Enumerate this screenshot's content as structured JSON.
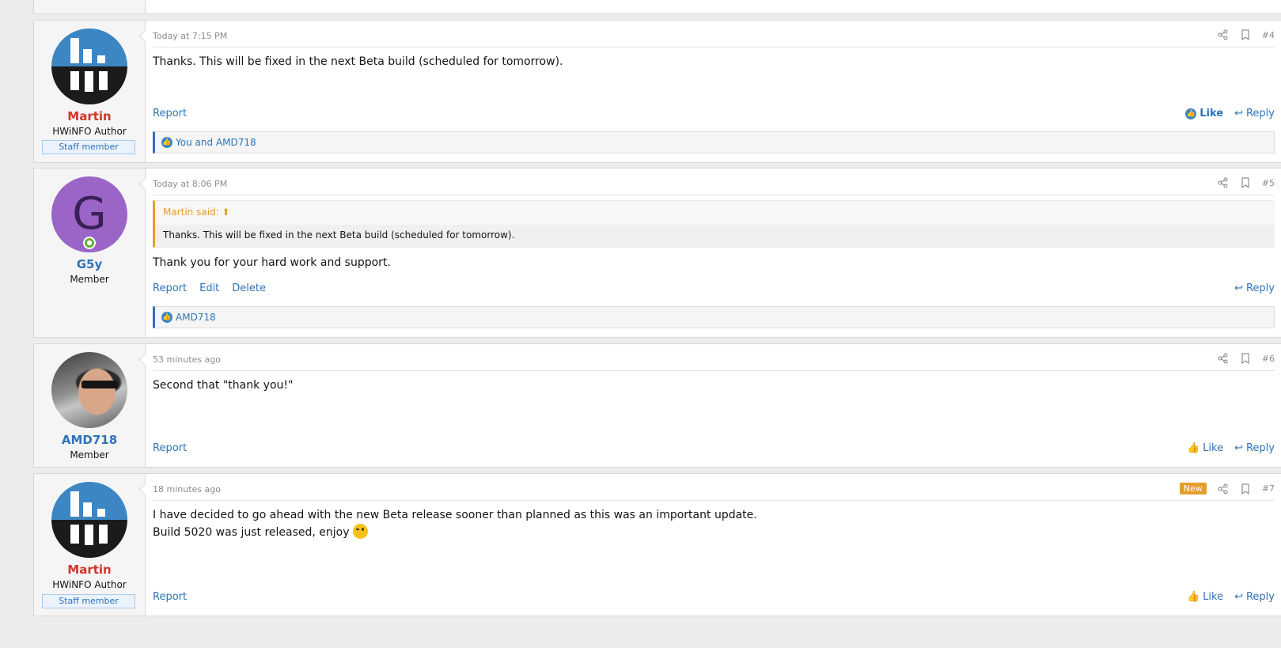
{
  "posts": [
    {
      "author": "Martin",
      "user_title": "HWiNFO Author",
      "staff_badge": "Staff member",
      "avatar": "hwinfo-logo-avatar",
      "time": "Today at 7:15 PM",
      "number": "#4",
      "body": "Thanks. This will be fixed in the next Beta build (scheduled for tomorrow).",
      "report": "Report",
      "like": "Like",
      "reply": "Reply",
      "reactions": "You and AMD718"
    },
    {
      "author": "G5y",
      "user_title": "Member",
      "avatar_letter": "G",
      "time": "Today at 8:06 PM",
      "number": "#5",
      "quote_author": "Martin said:",
      "quote_body": "Thanks. This will be fixed in the next Beta build (scheduled for tomorrow).",
      "body": "Thank you for your hard work and support.",
      "report": "Report",
      "edit": "Edit",
      "delete": "Delete",
      "reply": "Reply",
      "reactions": "AMD718"
    },
    {
      "author": "AMD718",
      "user_title": "Member",
      "avatar": "photo-avatar",
      "time": "53 minutes ago",
      "number": "#6",
      "body": "Second that \"thank you!\"",
      "report": "Report",
      "like": "Like",
      "reply": "Reply"
    },
    {
      "author": "Martin",
      "user_title": "HWiNFO Author",
      "staff_badge": "Staff member",
      "avatar": "hwinfo-logo-avatar",
      "time": "18 minutes ago",
      "new_badge": "New",
      "number": "#7",
      "body_line1": "I have decided to go ahead with the new Beta release sooner than planned as this was an important update.",
      "body_line2": "Build 5020 was just released, enjoy",
      "report": "Report",
      "like": "Like",
      "reply": "Reply"
    }
  ],
  "colors": {
    "link": "#2f73b7",
    "staff_name": "#d2352a",
    "new_badge": "#e39e2c"
  }
}
